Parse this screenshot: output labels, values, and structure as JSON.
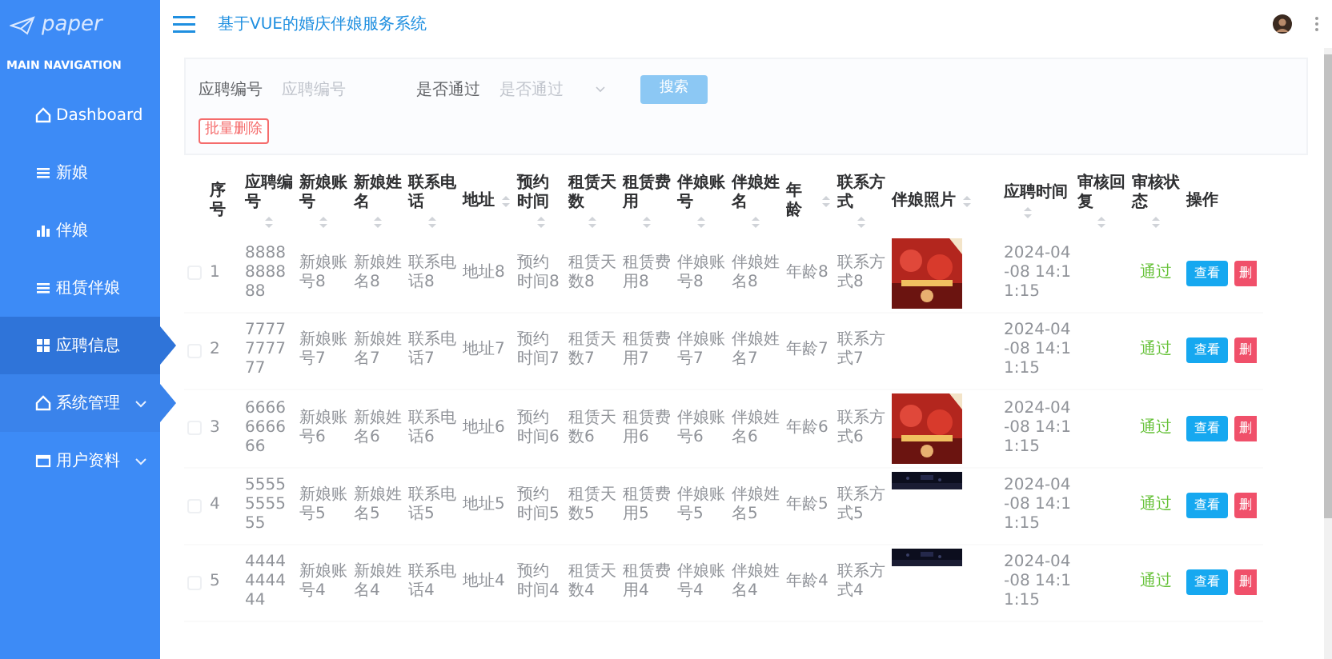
{
  "sidebar": {
    "logo": "paper",
    "section": "MAIN NAVIGATION",
    "items": [
      {
        "label": "Dashboard",
        "selected": false,
        "expandable": false,
        "hovered": false
      },
      {
        "label": "新娘",
        "selected": false,
        "expandable": false,
        "hovered": false
      },
      {
        "label": "伴娘",
        "selected": false,
        "expandable": false,
        "hovered": false
      },
      {
        "label": "租赁伴娘",
        "selected": false,
        "expandable": false,
        "hovered": false
      },
      {
        "label": "应聘信息",
        "selected": true,
        "expandable": false,
        "hovered": false
      },
      {
        "label": "系统管理",
        "selected": false,
        "expandable": true,
        "hovered": true
      },
      {
        "label": "用户资料",
        "selected": false,
        "expandable": true,
        "hovered": false
      }
    ]
  },
  "header": {
    "title": "基于VUE的婚庆伴娘服务系统"
  },
  "search": {
    "fields": [
      {
        "label": "应聘编号",
        "placeholder": "应聘编号",
        "kind": "input"
      },
      {
        "label": "是否通过",
        "placeholder": "是否通过",
        "kind": "select"
      }
    ],
    "button": "搜索",
    "batch_delete": "批量删除"
  },
  "table": {
    "columns": [
      {
        "label": "序号",
        "kind": "plain"
      },
      {
        "label": "应聘编号",
        "kind": "stacked"
      },
      {
        "label": "新娘账号",
        "kind": "stacked"
      },
      {
        "label": "新娘姓名",
        "kind": "stacked"
      },
      {
        "label": "联系电话",
        "kind": "stacked"
      },
      {
        "label": "地址",
        "kind": "inline"
      },
      {
        "label": "预约时间",
        "kind": "stacked"
      },
      {
        "label": "租赁天数",
        "kind": "stacked"
      },
      {
        "label": "租赁费用",
        "kind": "stacked"
      },
      {
        "label": "伴娘账号",
        "kind": "stacked"
      },
      {
        "label": "伴娘姓名",
        "kind": "stacked"
      },
      {
        "label": "年龄",
        "kind": "inline"
      },
      {
        "label": "联系方式",
        "kind": "stacked"
      },
      {
        "label": "伴娘照片",
        "kind": "inline"
      },
      {
        "label": "应聘时间",
        "kind": "stacked"
      },
      {
        "label": "审核回复",
        "kind": "stacked"
      },
      {
        "label": "审核状态",
        "kind": "stacked"
      },
      {
        "label": "操作",
        "kind": "plain"
      }
    ],
    "rows": [
      {
        "checked": false,
        "cells": [
          "1",
          "8888888888",
          "新娘账号8",
          "新娘姓名8",
          "联系电话8",
          "地址8",
          "预约时间8",
          "租赁天数8",
          "租赁费用8",
          "伴娘账号8",
          "伴娘姓名8",
          "年龄8",
          "联系方式8"
        ],
        "photo": {
          "kind": "picture",
          "cropped": false
        },
        "time": "2024-04-08 14:11:15",
        "status": "通过",
        "view": "查看",
        "delete": "删"
      },
      {
        "checked": false,
        "cells": [
          "2",
          "7777777777",
          "新娘账号7",
          "新娘姓名7",
          "联系电话7",
          "地址7",
          "预约时间7",
          "租赁天数7",
          "租赁费用7",
          "伴娘账号7",
          "伴娘姓名7",
          "年龄7",
          "联系方式7"
        ],
        "time": "2024-04-08 14:11:15",
        "status": "通过",
        "view": "查看",
        "delete": "删"
      },
      {
        "checked": false,
        "cells": [
          "3",
          "6666666666",
          "新娘账号6",
          "新娘姓名6",
          "联系电话6",
          "地址6",
          "预约时间6",
          "租赁天数6",
          "租赁费用6",
          "伴娘账号6",
          "伴娘姓名6",
          "年龄6",
          "联系方式6"
        ],
        "photo": {
          "kind": "picture",
          "cropped": false
        },
        "time": "2024-04-08 14:11:15",
        "status": "通过",
        "view": "查看",
        "delete": "删"
      },
      {
        "checked": false,
        "cells": [
          "4",
          "5555555555",
          "新娘账号5",
          "新娘姓名5",
          "联系电话5",
          "地址5",
          "预约时间5",
          "租赁天数5",
          "租赁费用5",
          "伴娘账号5",
          "伴娘姓名5",
          "年龄5",
          "联系方式5"
        ],
        "photo": {
          "kind": "picture",
          "cropped": true
        },
        "time": "2024-04-08 14:11:15",
        "status": "通过",
        "view": "查看",
        "delete": "删"
      },
      {
        "checked": false,
        "cells": [
          "5",
          "4444444444",
          "新娘账号4",
          "新娘姓名4",
          "联系电话4",
          "地址4",
          "预约时间4",
          "租赁天数4",
          "租赁费用4",
          "伴娘账号4",
          "伴娘姓名4",
          "年龄4",
          "联系方式4"
        ],
        "photo": {
          "kind": "picture",
          "cropped": true
        },
        "time": "2024-04-08 14:11:15",
        "status": "通过",
        "view": "查看",
        "delete": "删"
      }
    ]
  }
}
